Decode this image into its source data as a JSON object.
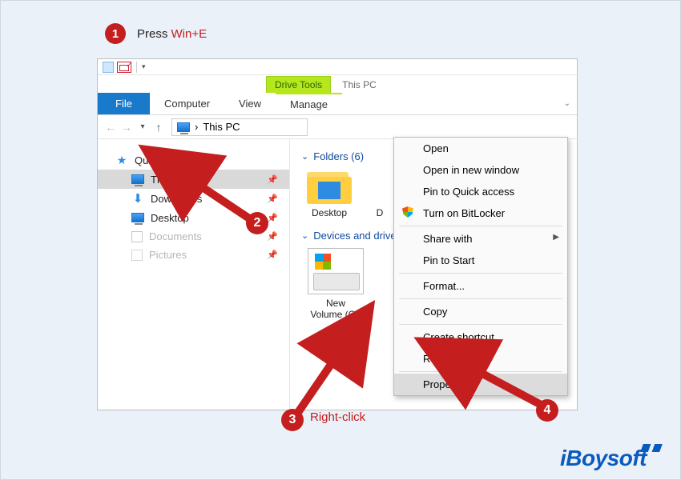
{
  "steps": {
    "1": {
      "num": "1",
      "label_prefix": "Press ",
      "label_hot": "Win+E"
    },
    "2": {
      "num": "2"
    },
    "3": {
      "num": "3",
      "label": "Right-click"
    },
    "4": {
      "num": "4"
    }
  },
  "explorer": {
    "context_tab": "Drive Tools",
    "title_tab": "This PC",
    "ribbon": {
      "file": "File",
      "computer": "Computer",
      "view": "View",
      "manage": "Manage"
    },
    "address": {
      "location": "This PC",
      "sep": "›"
    },
    "sidebar": {
      "quick": "Quick access",
      "items": [
        {
          "label": "This PC",
          "icon": "monitor"
        },
        {
          "label": "Downloads",
          "icon": "download"
        },
        {
          "label": "Desktop",
          "icon": "desktop"
        },
        {
          "label": "Documents",
          "icon": "document"
        },
        {
          "label": "Pictures",
          "icon": "pictures"
        }
      ]
    },
    "content": {
      "folders_hdr": "Folders (6)",
      "devices_hdr": "Devices and drives",
      "folders": [
        {
          "name": "Desktop"
        },
        {
          "name": "D"
        }
      ],
      "drive": {
        "line1": "New",
        "line2": "Volume (C:)"
      }
    }
  },
  "context_menu": [
    {
      "label": "Open"
    },
    {
      "label": "Open in new window"
    },
    {
      "label": "Pin to Quick access"
    },
    {
      "label": "Turn on BitLocker",
      "shield": true
    },
    {
      "sep": true
    },
    {
      "label": "Share with",
      "sub": true
    },
    {
      "label": "Pin to Start"
    },
    {
      "sep": true
    },
    {
      "label": "Format..."
    },
    {
      "sep": true
    },
    {
      "label": "Copy"
    },
    {
      "sep": true
    },
    {
      "label": "Create shortcut"
    },
    {
      "label": "Rename"
    },
    {
      "sep": true
    },
    {
      "label": "Properties",
      "sel": true
    }
  ],
  "brand": "iBoysoft"
}
